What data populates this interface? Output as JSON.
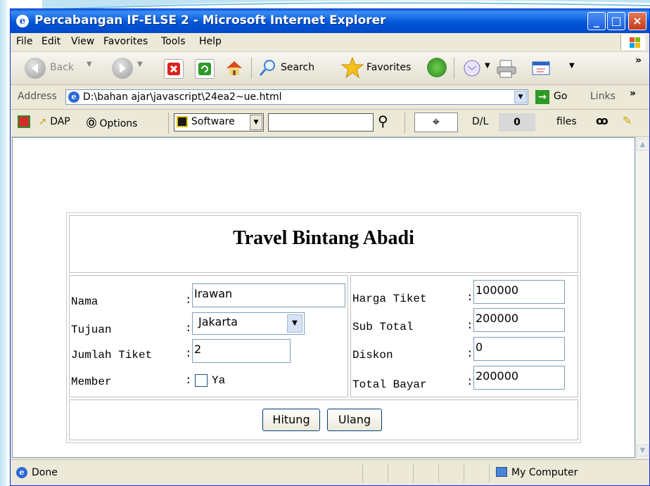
{
  "window": {
    "title": "Percabangan IF-ELSE 2 - Microsoft Internet Explorer",
    "min_glyph": "_",
    "max_glyph": "□",
    "close_glyph": "×"
  },
  "menu": [
    "File",
    "Edit",
    "View",
    "Favorites",
    "Tools",
    "Help"
  ],
  "toolbar": {
    "back_label": "Back",
    "search_label": "Search",
    "favorites_label": "Favorites",
    "chevron": "»"
  },
  "address": {
    "label": "Address",
    "url": "D:\\bahan ajar\\javascript\\24ea2~ue.html",
    "go_label": "Go",
    "links_label": "Links"
  },
  "toolbar2": {
    "dap_label": "DAP",
    "options_label": "Options",
    "software_value": "Software",
    "search_text": "",
    "dl_label": "D/L",
    "dl_count": "0",
    "files_label": "files"
  },
  "form": {
    "heading": "Travel Bintang Abadi",
    "nama_label": "Nama",
    "nama_value": "Irawan",
    "tujuan_label": "Tujuan",
    "tujuan_value": "Jakarta",
    "jumlah_label": "Jumlah Tiket",
    "jumlah_value": "2",
    "member_label": "Member",
    "member_option": "Ya",
    "member_checked": false,
    "harga_label": "Harga Tiket",
    "harga_value": "100000",
    "subtotal_label": "Sub Total",
    "subtotal_value": "200000",
    "diskon_label": "Diskon",
    "diskon_value": "0",
    "total_label": "Total Bayar",
    "total_value": "200000",
    "colon": ":",
    "hitung_label": "Hitung",
    "ulang_label": "Ulang"
  },
  "status": {
    "text": "Done",
    "zone": "My Computer"
  },
  "colors": {
    "titlebar": "#0256d8",
    "chrome": "#ece9d8",
    "input_border": "#7f9db9"
  }
}
